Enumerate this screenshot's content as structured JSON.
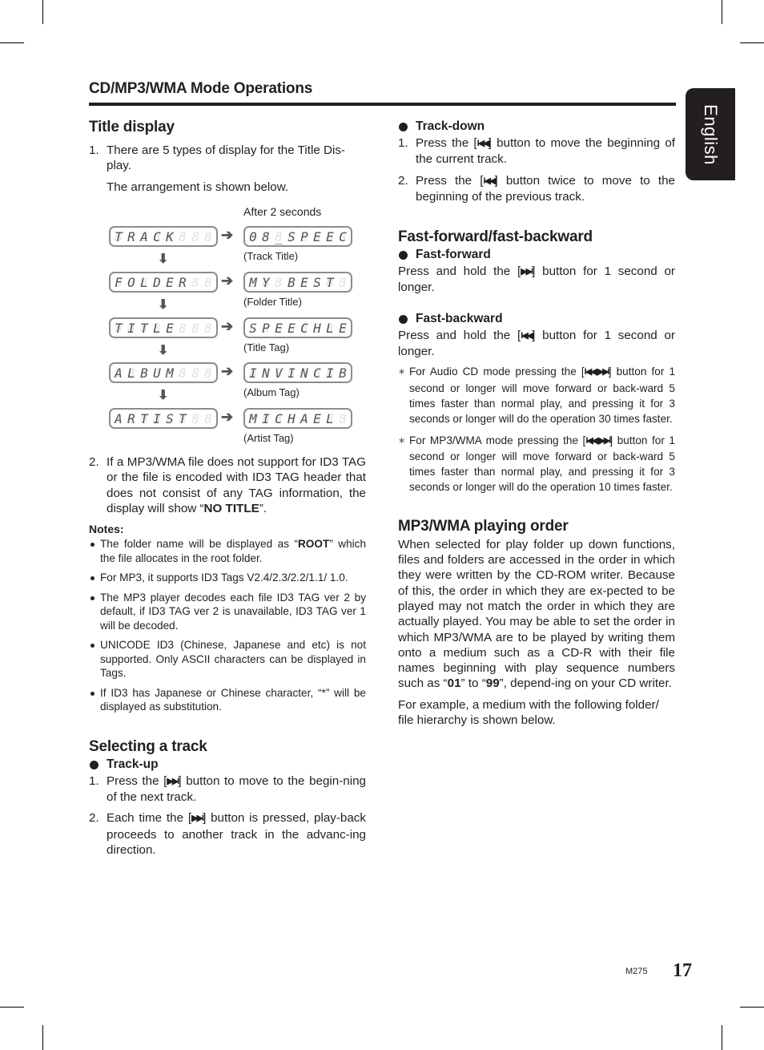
{
  "section_header": "CD/MP3/WMA Mode Operations",
  "language_tab": "English",
  "left_column": {
    "title_display": {
      "heading": "Title display",
      "item1_num": "1.",
      "item1_text": "There are 5 types of display for the Title Dis-play.",
      "item1_sub": "The arrangement is shown below.",
      "diagram": {
        "after_label": "After 2 seconds",
        "rows": [
          {
            "left": [
              "T",
              "R",
              "A",
              "C",
              "K",
              "",
              "",
              ""
            ],
            "right": [
              "0",
              "8",
              "_",
              "S",
              "P",
              "E",
              "E",
              "C"
            ],
            "caption": "(Track Title)"
          },
          {
            "left": [
              "F",
              "O",
              "L",
              "D",
              "E",
              "R",
              "",
              ""
            ],
            "right": [
              "M",
              "Y",
              "",
              "B",
              "E",
              "S",
              "T",
              ""
            ],
            "caption": "(Folder Title)"
          },
          {
            "left": [
              "T",
              "I",
              "T",
              "L",
              "E",
              "",
              "",
              ""
            ],
            "right": [
              "S",
              "P",
              "E",
              "E",
              "C",
              "H",
              "L",
              "E"
            ],
            "caption": "(Title Tag)"
          },
          {
            "left": [
              "A",
              "L",
              "B",
              "U",
              "M",
              "",
              "",
              ""
            ],
            "right": [
              "I",
              "N",
              "V",
              "I",
              "N",
              "C",
              "I",
              "B"
            ],
            "caption": "(Album Tag)"
          },
          {
            "left": [
              "A",
              "R",
              "T",
              "I",
              "S",
              "T",
              "",
              ""
            ],
            "right": [
              "M",
              "I",
              "C",
              "H",
              "A",
              "E",
              "L",
              ""
            ],
            "caption": "(Artist Tag)"
          }
        ],
        "arrow_right": "➔",
        "arrow_down": "⬇"
      },
      "item2_num": "2.",
      "item2_text_a": "If a MP3/WMA file does not support for ID3 TAG or the file is encoded with ID3 TAG header that does not consist of any TAG information, the display will show “",
      "item2_bold": "NO TITLE",
      "item2_text_b": "”."
    },
    "notes": {
      "heading": "Notes:",
      "items": [
        {
          "a": "The folder name will be displayed as “",
          "b": "ROOT",
          "c": "” which the file allocates in the root folder."
        },
        {
          "a": "For MP3, it supports ID3 Tags V2.4/2.3/2.2/1.1/ 1.0.",
          "b": "",
          "c": ""
        },
        {
          "a": "The MP3 player decodes each file ID3 TAG ver 2 by default, if ID3 TAG ver 2 is unavailable, ID3 TAG ver 1 will be decoded.",
          "b": "",
          "c": ""
        },
        {
          "a": "UNICODE ID3 (Chinese, Japanese and etc) is not supported. Only ASCII characters can be displayed in Tags.",
          "b": "",
          "c": ""
        },
        {
          "a": "If ID3 has Japanese or Chinese character, “*” will be displayed as substitution.",
          "b": "",
          "c": ""
        }
      ]
    },
    "selecting": {
      "heading": "Selecting a track",
      "sub": "Track-up",
      "items": [
        {
          "num": "1.",
          "a": "Press the [",
          "icon": "▶▶I",
          "b": "] button to move to the begin-ning of the next track."
        },
        {
          "num": "2.",
          "a": "Each time the [",
          "icon": "▶▶I",
          "b": "] button is pressed, play-back proceeds to another track in the advanc-ing direction."
        }
      ]
    }
  },
  "right_column": {
    "track_down": {
      "sub": "Track-down",
      "items": [
        {
          "num": "1.",
          "a": "Press the [",
          "icon": "I◀◀",
          "b": "] button to move the beginning of the current track."
        },
        {
          "num": "2.",
          "a": "Press the [",
          "icon": "I◀◀",
          "b": "] button twice to move to the beginning of the previous track."
        }
      ]
    },
    "fast": {
      "heading": "Fast-forward/fast-backward",
      "ff_sub": "Fast-forward",
      "ff_a": "Press and hold the [",
      "ff_icon": "▶▶I",
      "ff_b": "] button for 1 second or longer.",
      "fb_sub": "Fast-backward",
      "fb_a": "Press and hold the [",
      "fb_icon": "I◀◀",
      "fb_b": "] button for 1 second or longer.",
      "star_mark": "∗",
      "notes": [
        {
          "a": "For Audio CD mode pressing the [",
          "icon": "I◀◀, ▶▶I",
          "b": "] button for 1 second or longer will move forward or back-ward 5 times faster than normal play, and pressing it for 3 seconds or longer will do the operation 30 times faster."
        },
        {
          "a": "For MP3/WMA mode pressing the [",
          "icon": "I◀◀, ▶▶I",
          "b": "] button for 1 second or longer will move forward or back-ward 5 times faster than normal play, and pressing it for 3 seconds or longer will do the operation 10 times faster."
        }
      ]
    },
    "order": {
      "heading": "MP3/WMA playing order",
      "p1_a": "When selected for play folder up down functions, files and folders are accessed in the order in which they were written by the CD-ROM writer. Because of this, the order in which they are ex-pected to be played may not match the order in which they are actually played. You may be able to set the order in which MP3/WMA are to be played by writing them onto a medium such as a CD-R with their file names beginning with play sequence numbers such as “",
      "p1_b1": "01",
      "p1_c": "” to “",
      "p1_b2": "99",
      "p1_d": "”, depend-ing on your CD writer.",
      "p2": "For example, a medium with the following folder/ file hierarchy is shown below."
    }
  },
  "footer": {
    "model": "M275",
    "page_number": "17"
  }
}
